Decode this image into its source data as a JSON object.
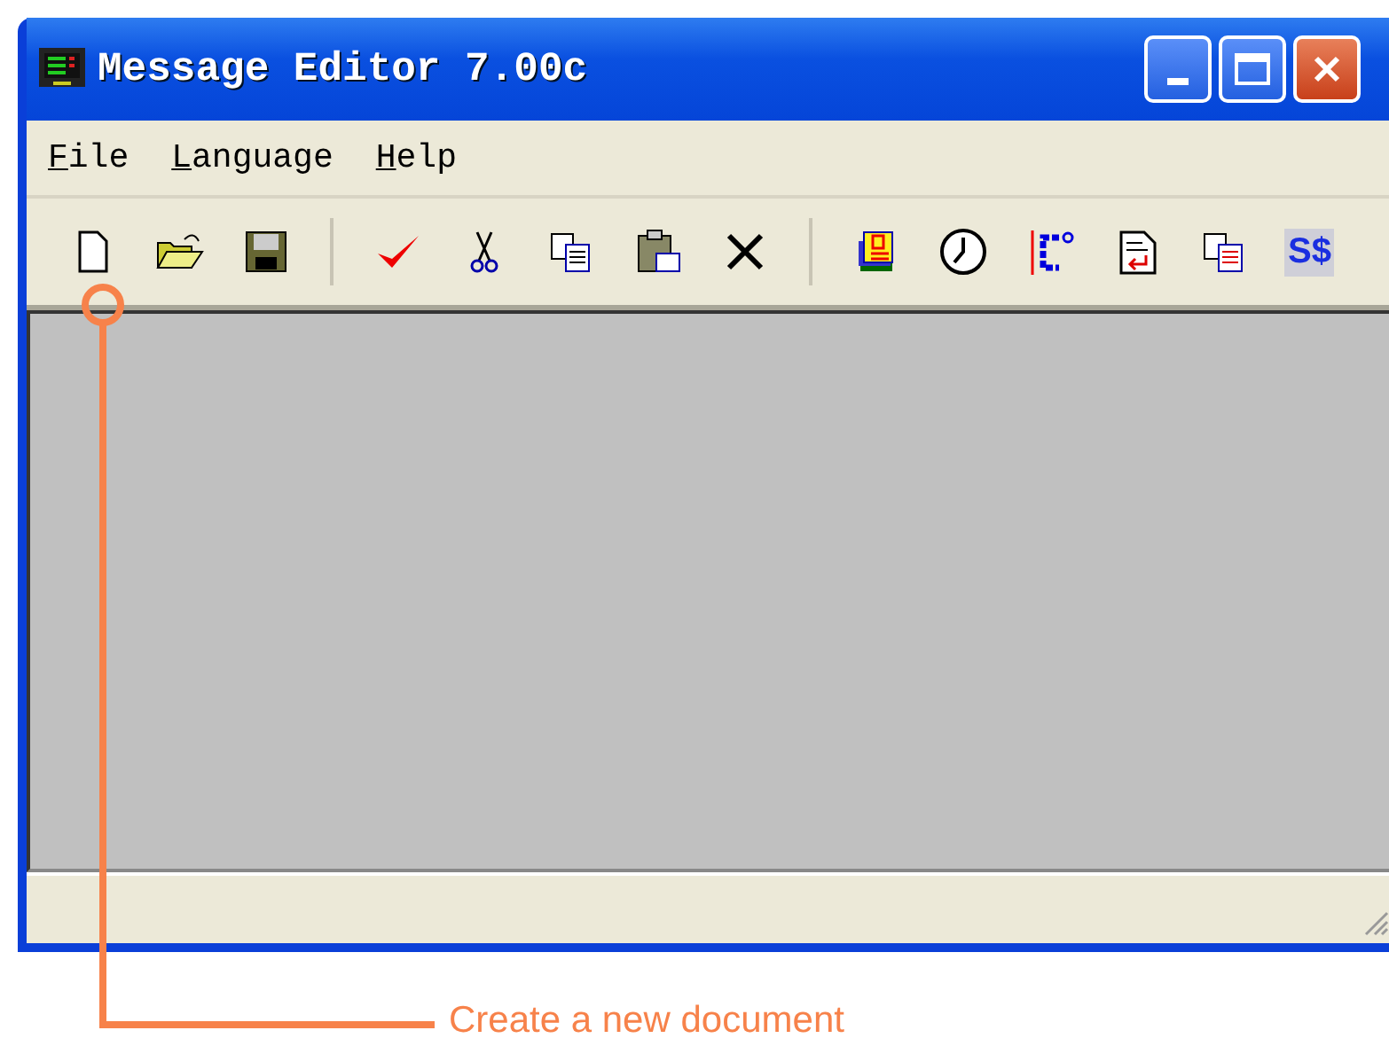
{
  "window": {
    "title": "Message Editor 7.00c"
  },
  "menu": [
    {
      "label": "File"
    },
    {
      "label": "Language"
    },
    {
      "label": "Help"
    }
  ],
  "toolbar": [
    {
      "kind": "new"
    },
    {
      "kind": "open"
    },
    {
      "kind": "save"
    },
    {
      "kind": "sep"
    },
    {
      "kind": "check"
    },
    {
      "kind": "cut"
    },
    {
      "kind": "copy"
    },
    {
      "kind": "paste"
    },
    {
      "kind": "delete"
    },
    {
      "kind": "sep"
    },
    {
      "kind": "book"
    },
    {
      "kind": "clock"
    },
    {
      "kind": "temp"
    },
    {
      "kind": "doc"
    },
    {
      "kind": "copy2"
    },
    {
      "kind": "currency",
      "text": "S$"
    }
  ],
  "callout": {
    "text": "Create a new document"
  }
}
